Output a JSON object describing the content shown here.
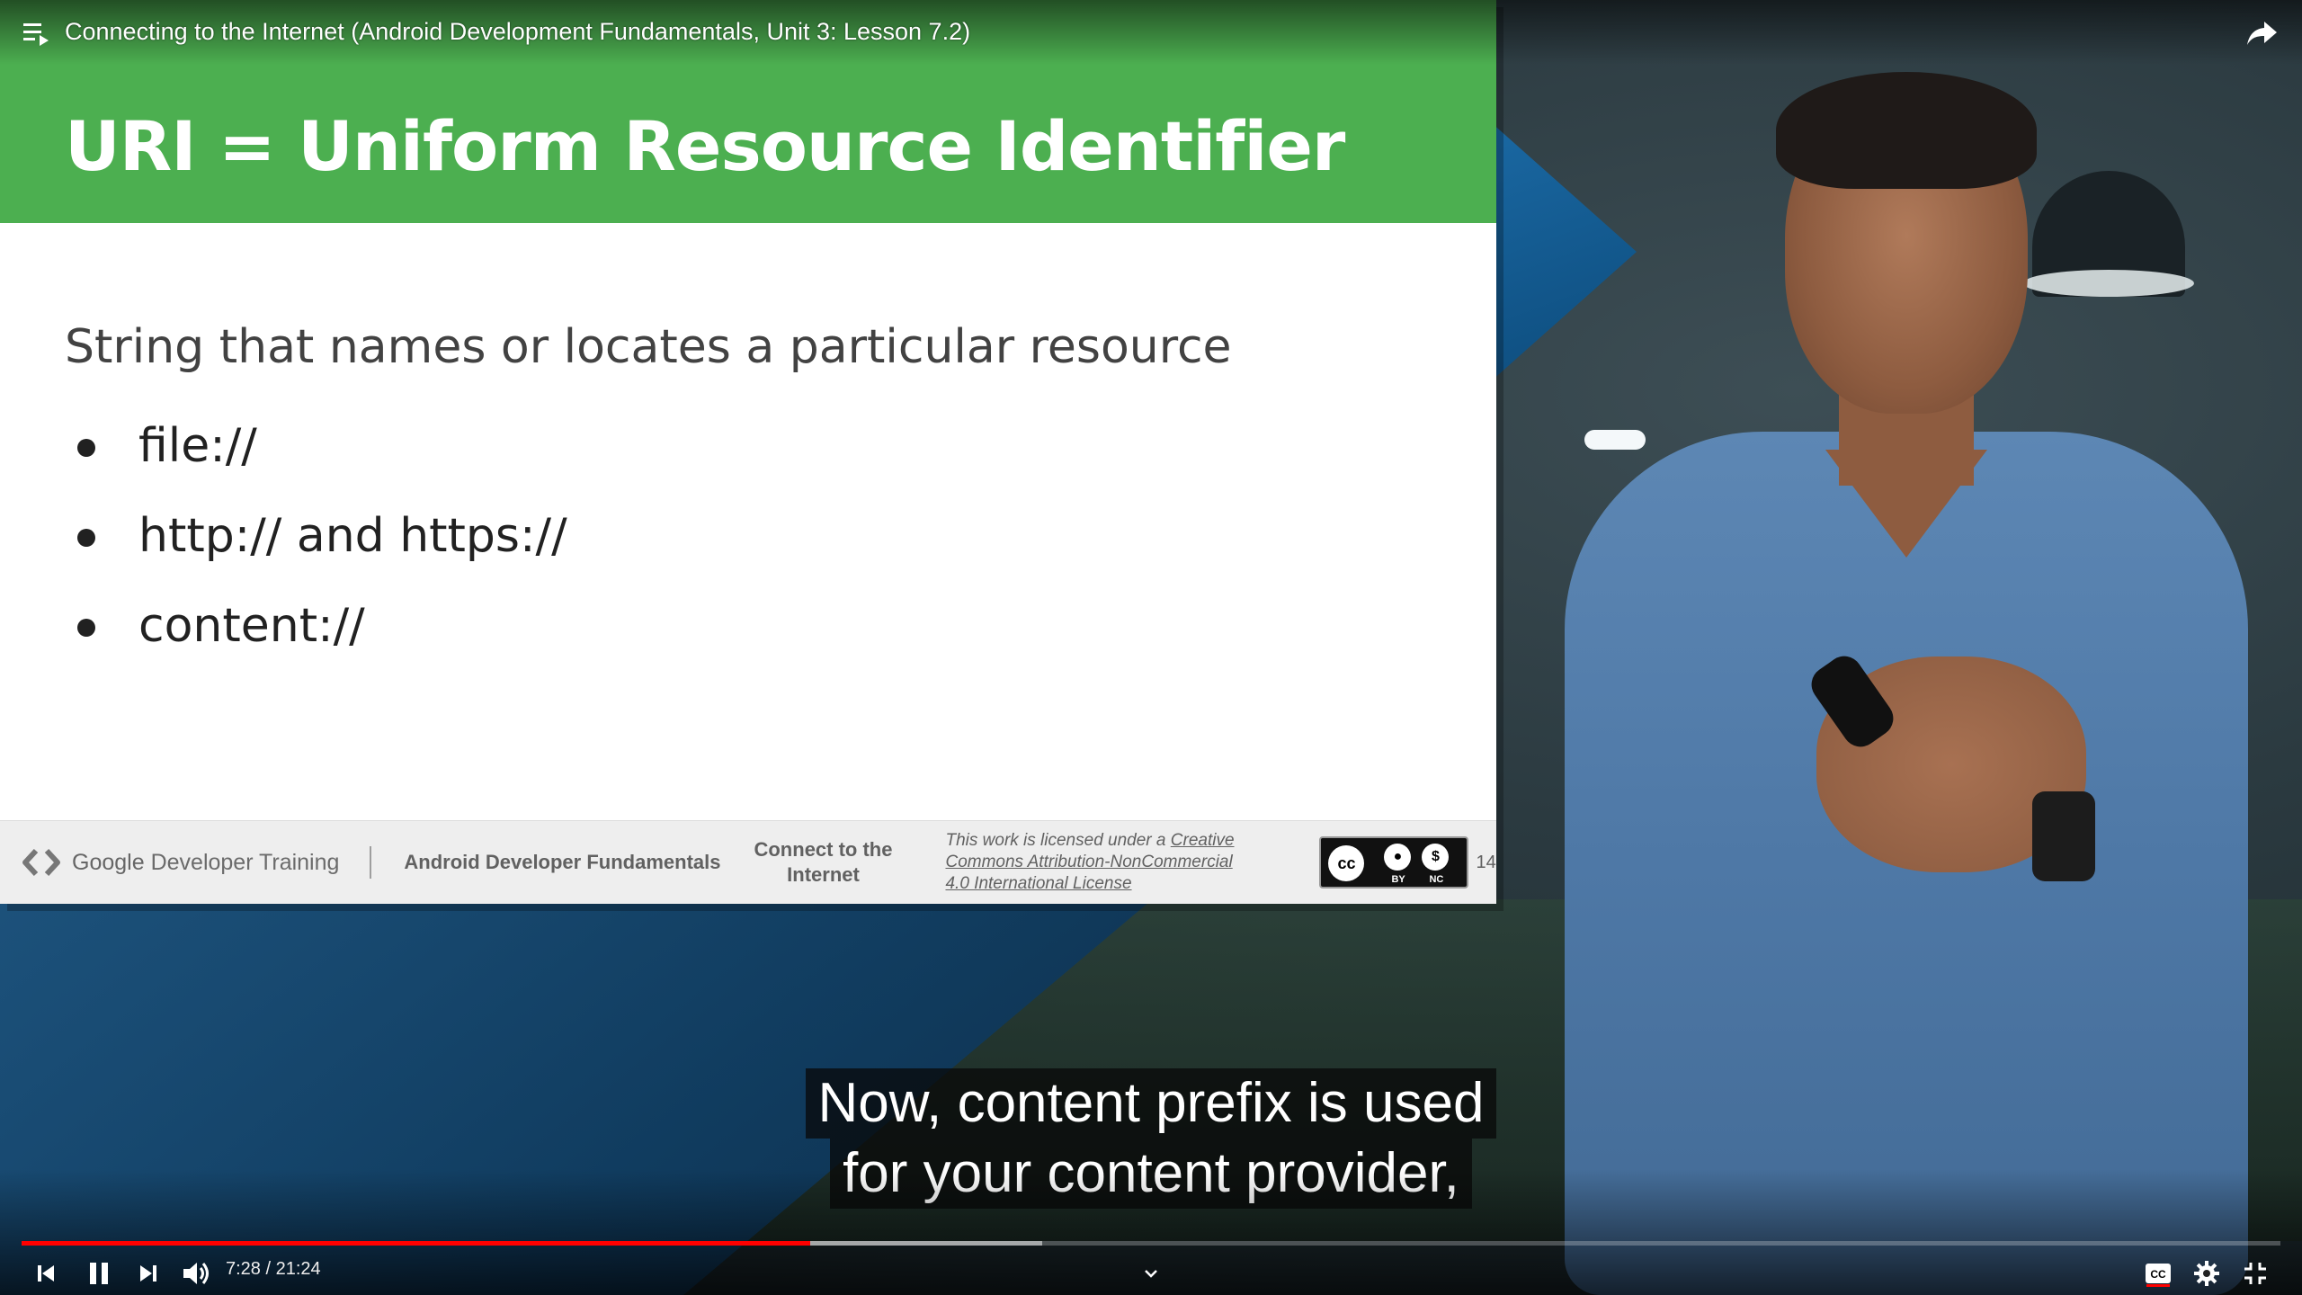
{
  "player": {
    "video_title": "Connecting to the Internet (Android Development Fundamentals, Unit 3: Lesson 7.2)",
    "time_display": "7:28 / 21:24",
    "progress": {
      "played_fraction": 0.349,
      "buffered_fraction": 0.452
    },
    "captions": {
      "line1": "Now, content prefix is used",
      "line2": "for your content provider,"
    },
    "accent_color": "#ff0000"
  },
  "slide": {
    "title": "URI = Uniform Resource Identifier",
    "lead": "String that names or locates a particular resource",
    "bullets": [
      "file://",
      "http:// and https://",
      "content://"
    ],
    "header_color": "#4caf50",
    "footer": {
      "brand_google": "Google",
      "brand_rest": "Developer Training",
      "course": "Android Developer Fundamentals",
      "lesson_line1": "Connect to the",
      "lesson_line2": "Internet",
      "license_prefix": "This work is licensed under a",
      "license_link1": "Creative",
      "license_link2": "Commons Attribution-NonCommercial",
      "license_link3": "4.0 International License",
      "cc_by_label": "BY",
      "cc_nc_label": "NC",
      "cc_label": "cc",
      "page_number": "14"
    }
  },
  "icons": {
    "playlist": "playlist-icon",
    "share": "share-icon",
    "previous": "previous-icon",
    "pause": "pause-icon",
    "next": "next-icon",
    "volume": "volume-icon",
    "chevron": "chevron-down-icon",
    "subtitles": "subtitles-icon",
    "settings": "gear-icon",
    "exit_fullscreen": "exit-fullscreen-icon"
  }
}
